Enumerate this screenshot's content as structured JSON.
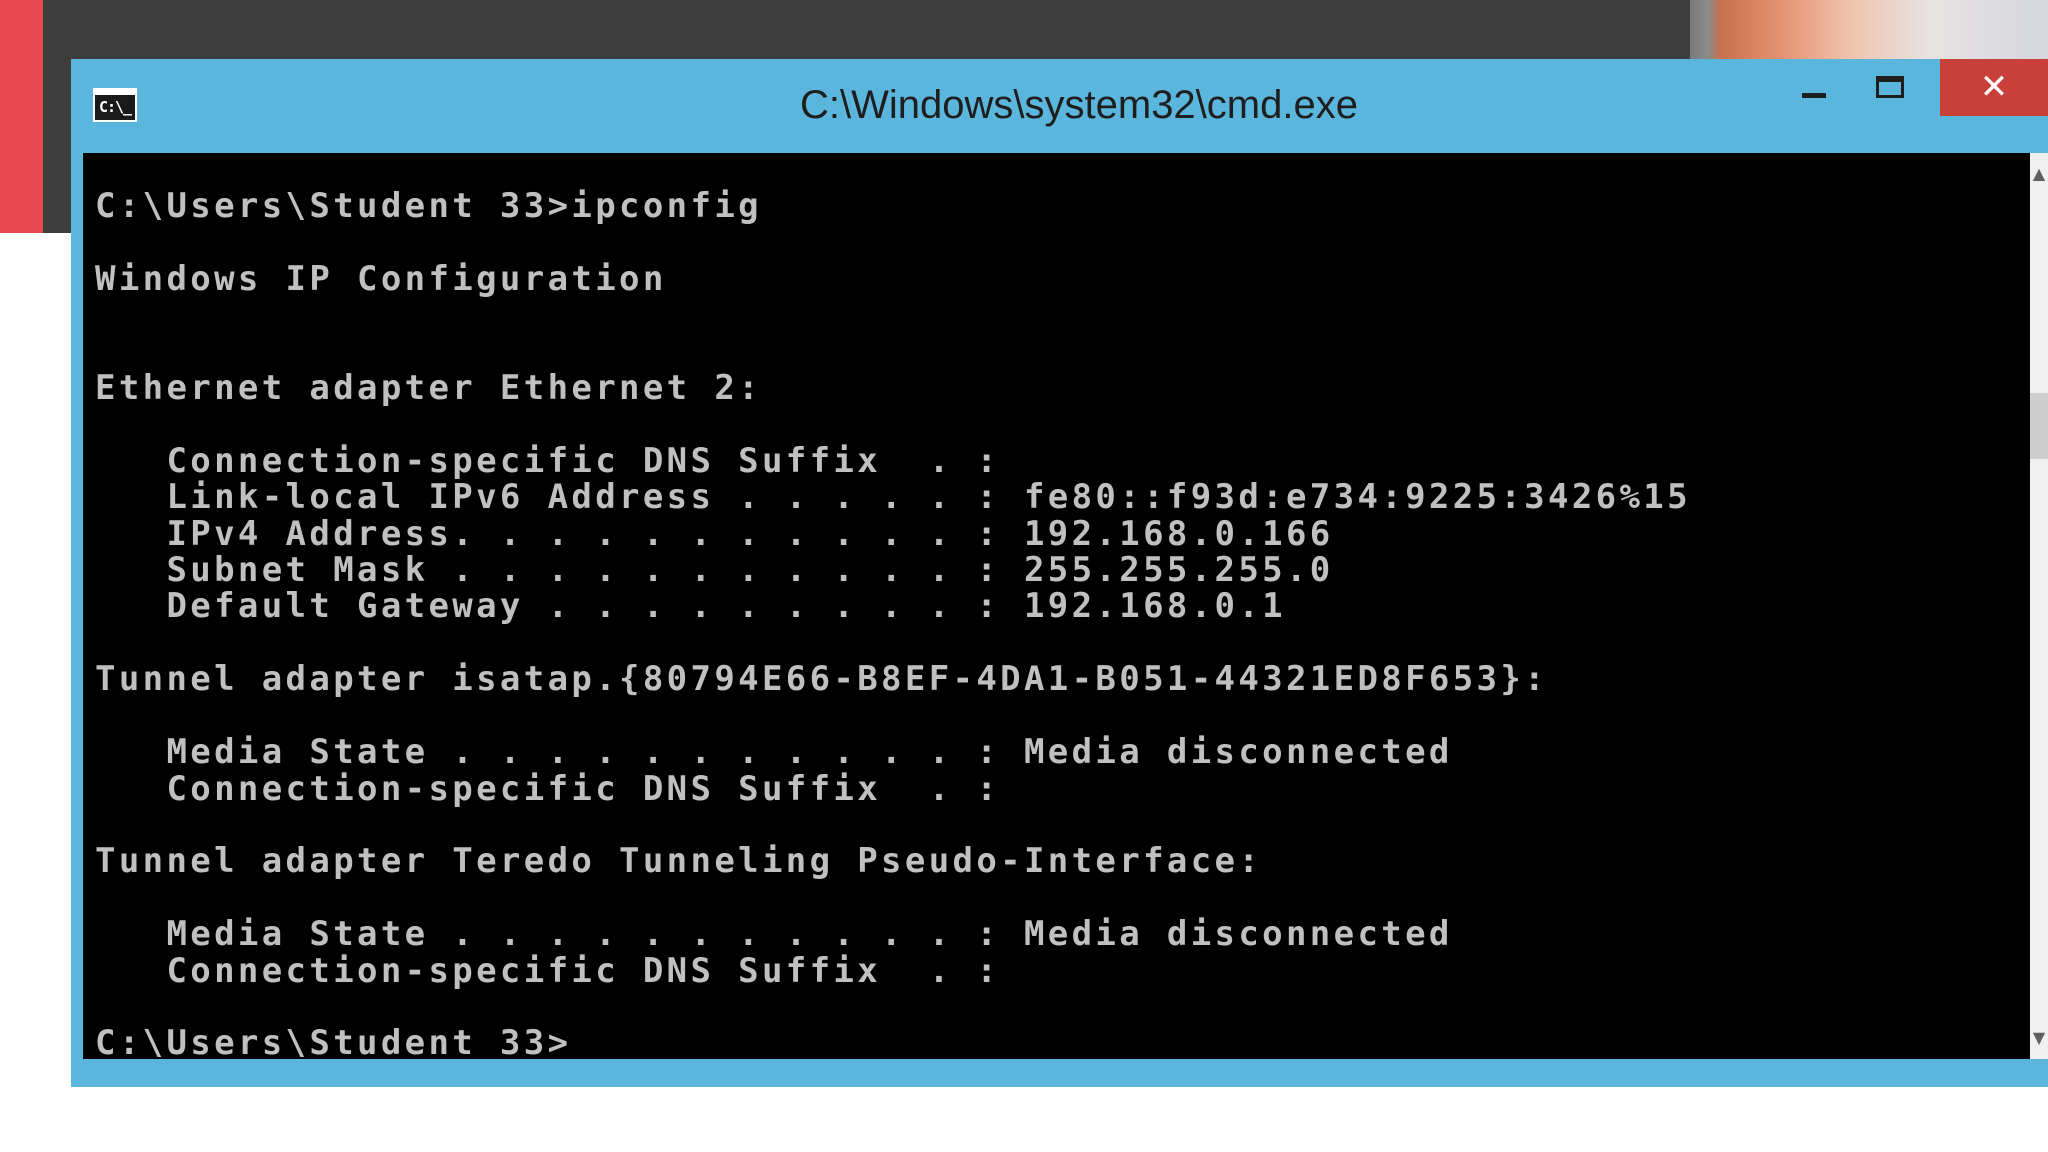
{
  "window": {
    "title": "C:\\Windows\\system32\\cmd.exe",
    "icon_text": "C:\\_",
    "icon_name": "command-prompt-icon",
    "controls": {
      "minimize_icon": "minimize-icon",
      "maximize_icon": "maximize-icon",
      "close_symbol": "✕"
    }
  },
  "console": {
    "text_color": "#c0c0c0",
    "background": "#000000",
    "lines": [
      "C:\\Users\\Student 33>ipconfig",
      "",
      "Windows IP Configuration",
      "",
      "",
      "Ethernet adapter Ethernet 2:",
      "",
      "   Connection-specific DNS Suffix  . :",
      "   Link-local IPv6 Address . . . . . : fe80::f93d:e734:9225:3426%15",
      "   IPv4 Address. . . . . . . . . . . : 192.168.0.166",
      "   Subnet Mask . . . . . . . . . . . : 255.255.255.0",
      "   Default Gateway . . . . . . . . . : 192.168.0.1",
      "",
      "Tunnel adapter isatap.{80794E66-B8EF-4DA1-B051-44321ED8F653}:",
      "",
      "   Media State . . . . . . . . . . . : Media disconnected",
      "   Connection-specific DNS Suffix  . :",
      "",
      "Tunnel adapter Teredo Tunneling Pseudo-Interface:",
      "",
      "   Media State . . . . . . . . . . . : Media disconnected",
      "   Connection-specific DNS Suffix  . :",
      "",
      "C:\\Users\\Student 33>"
    ]
  },
  "scrollbar": {
    "up_symbol": "▲",
    "down_symbol": "▼"
  },
  "colors": {
    "title_bar": "#5ab6dc",
    "close_button": "#c9403a",
    "desktop_accent": "#e8484f"
  }
}
